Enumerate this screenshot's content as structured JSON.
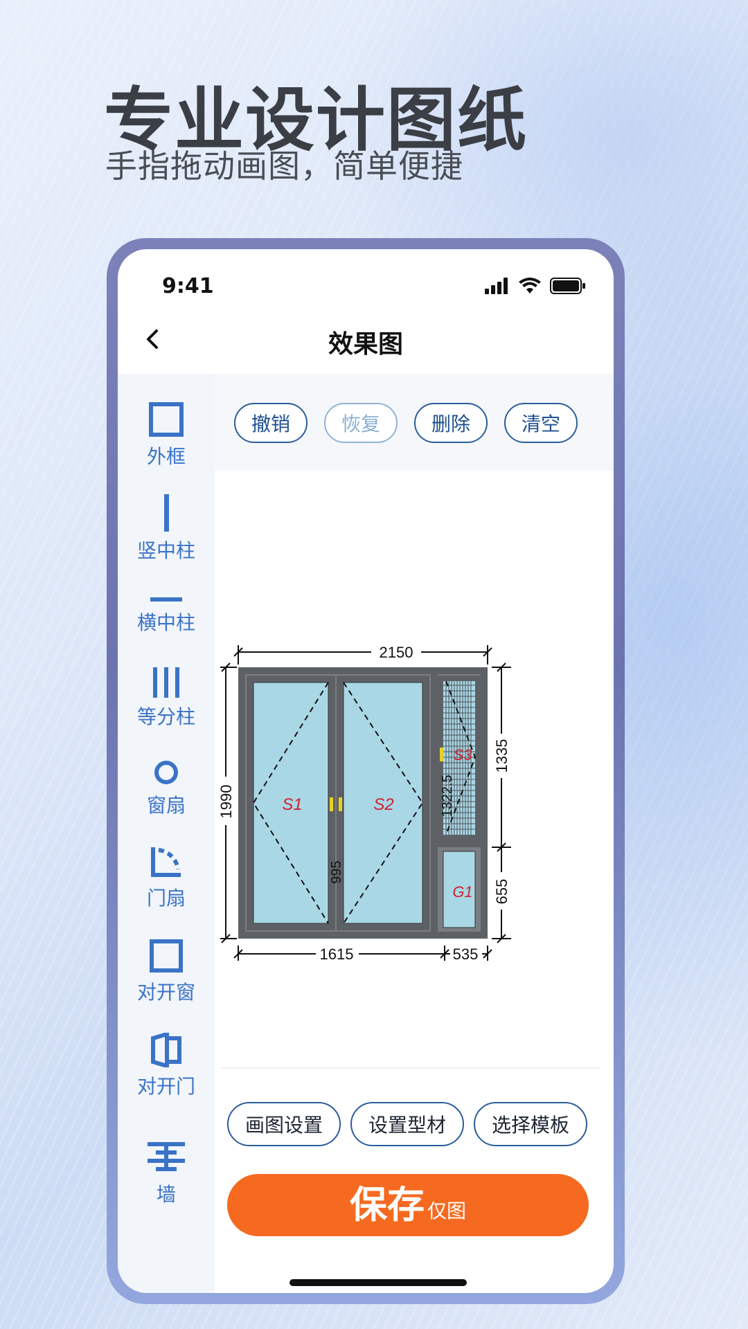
{
  "promo": {
    "headline": "专业设计图纸",
    "subline": "手指拖动画图，简单便捷"
  },
  "status_bar": {
    "time": "9:41"
  },
  "nav": {
    "title": "效果图"
  },
  "toolbar": {
    "undo": "撤销",
    "redo": "恢复",
    "delete": "删除",
    "clear": "清空"
  },
  "sidebar": {
    "items": [
      {
        "label": "外框",
        "icon": "square-frame-icon"
      },
      {
        "label": "竖中柱",
        "icon": "vertical-bar-icon"
      },
      {
        "label": "横中柱",
        "icon": "horizontal-bar-icon"
      },
      {
        "label": "等分柱",
        "icon": "triple-bar-icon"
      },
      {
        "label": "窗扇",
        "icon": "circle-icon"
      },
      {
        "label": "门扇",
        "icon": "door-swing-icon"
      },
      {
        "label": "对开窗",
        "icon": "square-frame-icon"
      },
      {
        "label": "对开门",
        "icon": "double-door-icon"
      },
      {
        "label": "墙",
        "icon": "wall-icon"
      }
    ]
  },
  "drawing": {
    "dim_total_width": "2150",
    "dim_total_height": "1990",
    "dim_left_width": "1615",
    "dim_right_width": "535",
    "dim_right_top": "1335",
    "dim_right_bottom": "655",
    "dim_mid_vertical": "995",
    "dim_right_inner": "1322.5",
    "sash1": "S1",
    "sash2": "S2",
    "sash3": "S3",
    "glass1": "G1"
  },
  "options": {
    "draw_settings": "画图设置",
    "set_profile": "设置型材",
    "choose_template": "选择模板"
  },
  "save": {
    "main": "保存",
    "sub": "仅图"
  },
  "colors": {
    "accent_blue": "#3a73c6",
    "save_orange": "#f56a20",
    "frame_gray": "#5d6166",
    "glass": "#a9d7e5"
  }
}
